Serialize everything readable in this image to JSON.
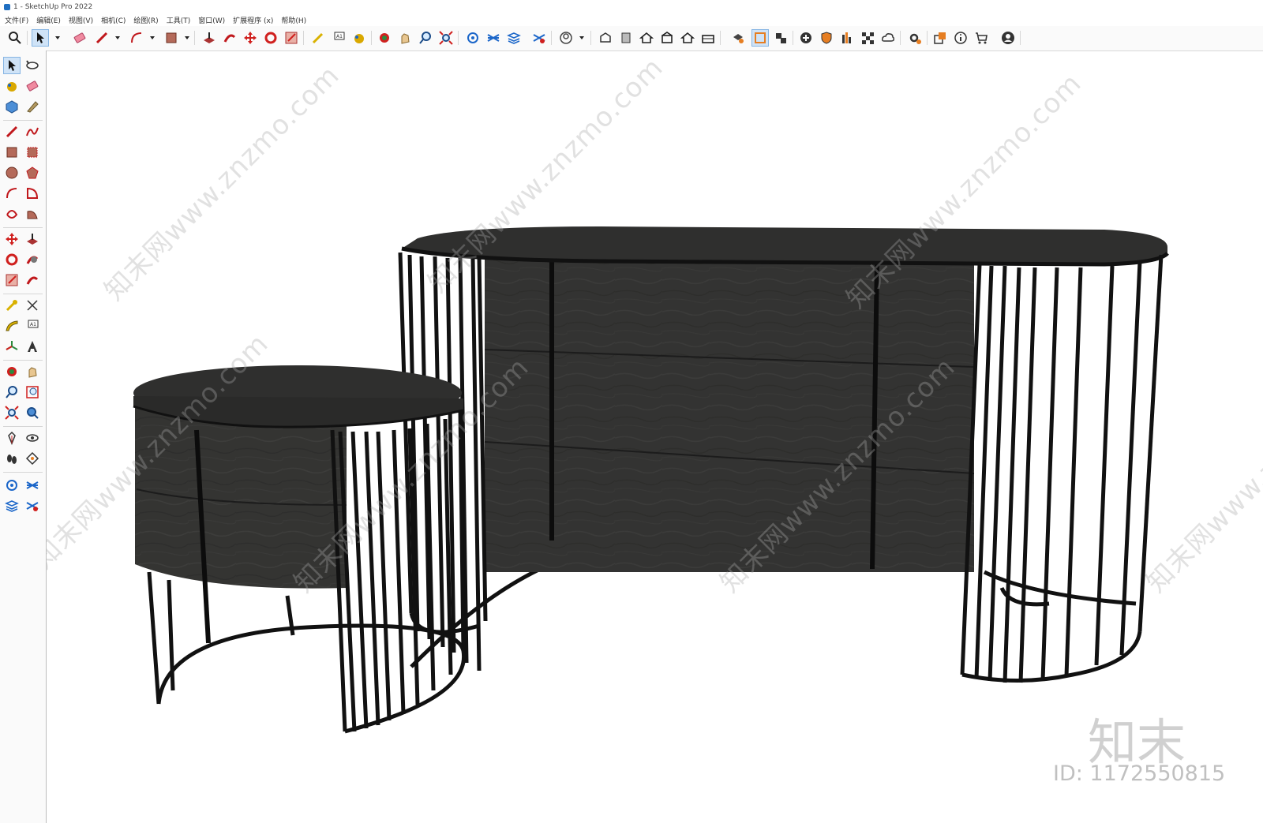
{
  "window": {
    "title": "1 - SketchUp Pro 2022"
  },
  "menu": [
    "文件(F)",
    "编辑(E)",
    "视图(V)",
    "相机(C)",
    "绘图(R)",
    "工具(T)",
    "窗口(W)",
    "扩展程序 (x)",
    "帮助(H)"
  ],
  "toolbar": {
    "icons": [
      "search",
      "select",
      "eraser",
      "pencil",
      "arc",
      "rectangle",
      "push-pull",
      "follow-me",
      "move",
      "rotate",
      "scale",
      "tape",
      "text",
      "paint",
      "orbit",
      "pan",
      "zoom",
      "zoom-extents",
      "geo",
      "sandbox",
      "layers",
      "outliner",
      "user",
      "view-iso",
      "view-front",
      "view-top",
      "view-right",
      "view-back",
      "view-left",
      "style",
      "section",
      "components",
      "add",
      "shield",
      "report",
      "checker",
      "cloud",
      "extensions",
      "send",
      "info",
      "cart",
      "account"
    ]
  },
  "left_toolbar": {
    "icons": [
      "select",
      "orbit",
      "paint",
      "eraser",
      "component",
      "tape",
      "pencil",
      "freehand",
      "rectangle",
      "rotated-rect",
      "circle",
      "polygon",
      "arc",
      "pie",
      "arc3",
      "arc2",
      "move",
      "push-pull",
      "rotate",
      "follow-me",
      "scale",
      "offset",
      "tape-measure",
      "dimension",
      "protractor",
      "text",
      "axes",
      "3d-text",
      "orbit2",
      "pan",
      "zoom",
      "zoom-window",
      "zoom-extents",
      "previous",
      "position-camera",
      "look-around",
      "walk",
      "section-plane",
      "sandbox1",
      "sandbox2",
      "sandbox3",
      "sandbox4"
    ]
  },
  "watermarks": [
    "知末网www.znzmo.com",
    "知末网www.znzmo.com",
    "知末网www.znzmo.com",
    "知末网www.znzmo.com",
    "知末网www.znzmo.com",
    "知末网www.znzmo.com",
    "知末网www.znzmo.com",
    "知末网www.znzmo.com"
  ],
  "brand": {
    "name": "知末",
    "id": "ID: 1172550815"
  }
}
